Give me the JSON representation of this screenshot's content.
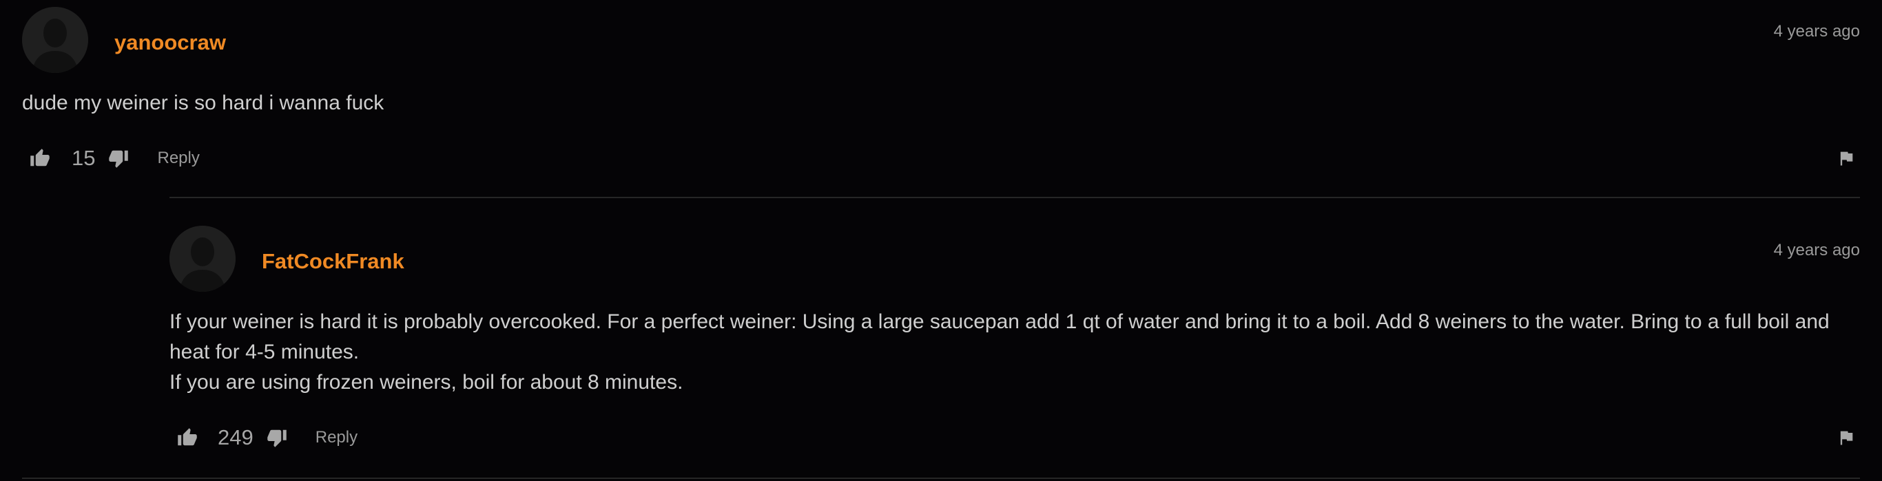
{
  "comments": [
    {
      "username": "yanoocraw",
      "time": "4 years ago",
      "text": [
        "dude my weiner is so hard i wanna fuck"
      ],
      "likes": "15",
      "reply_label": "Reply"
    },
    {
      "username": "FatCockFrank",
      "time": "4 years ago",
      "text": [
        "If your weiner is hard it is probably overcooked. For a perfect weiner: Using a large saucepan add 1 qt of water and bring it to a boil. Add 8 weiners to the water. Bring to a full boil and heat for 4-5 minutes.",
        "If you are using frozen weiners, boil for about 8 minutes."
      ],
      "likes": "249",
      "reply_label": "Reply"
    }
  ],
  "colors": {
    "background": "#050406",
    "username": "#f08a24",
    "text": "#cfcfcf",
    "muted": "#9a9a9a",
    "divider": "#262626"
  },
  "icons": {
    "like": "thumbs-up-icon",
    "dislike": "thumbs-down-icon",
    "flag": "flag-icon",
    "avatar": "default-avatar-silhouette"
  }
}
